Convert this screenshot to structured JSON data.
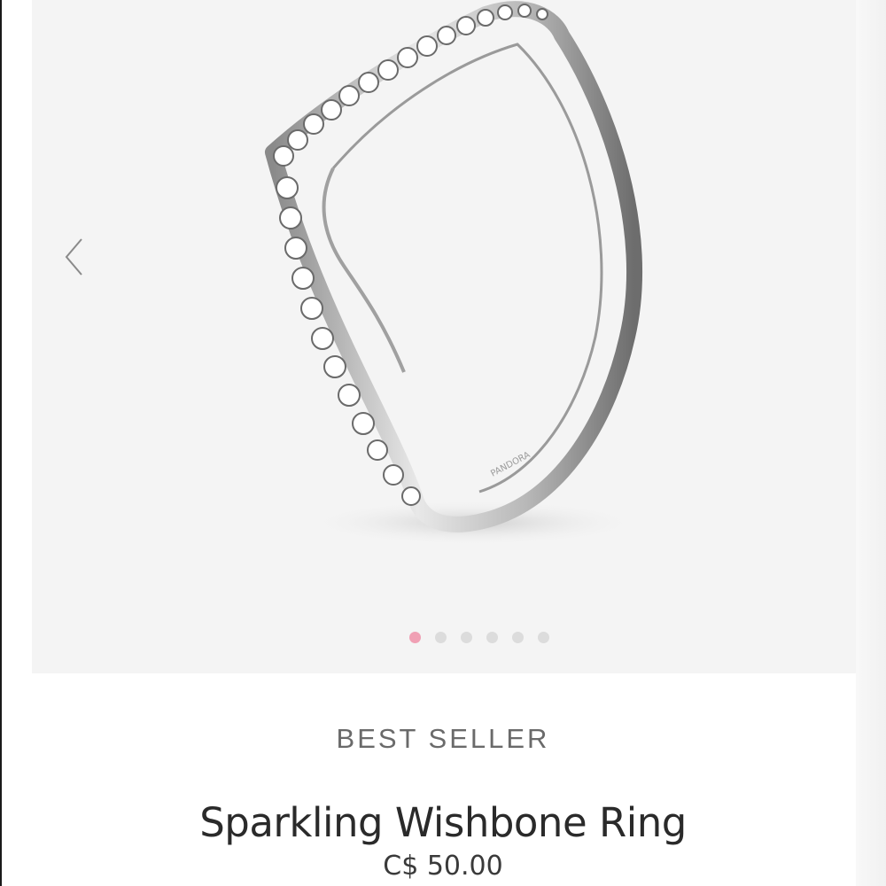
{
  "gallery": {
    "image_alt": "Sparkling Wishbone Ring",
    "prev_icon": "chevron-left-icon",
    "next_icon": "chevron-right-icon",
    "dot_count": 6,
    "active_index": 0,
    "active_dot_color": "#f0a0b4",
    "inactive_dot_color": "#dcdcdc"
  },
  "product": {
    "badge": "BEST SELLER",
    "name": "Sparkling Wishbone Ring",
    "price": "C$ 50.00"
  }
}
